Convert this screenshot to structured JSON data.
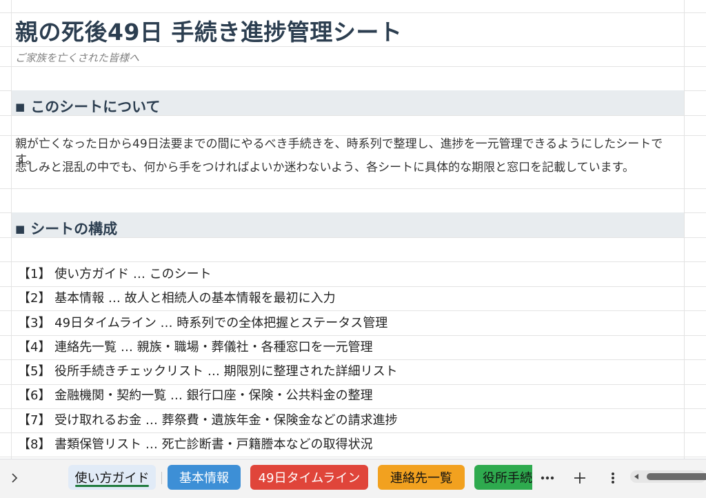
{
  "title": "親の死後49日 手続き進捗管理シート",
  "subtitle": "ご家族を亡くされた皆様へ",
  "about": {
    "bullet": "■",
    "heading": "このシートについて",
    "line1": "親が亡くなった日から49日法要までの間にやるべき手続きを、時系列で整理し、進捗を一元管理できるようにしたシートです。",
    "line2": "悲しみと混乱の中でも、何から手をつければよいか迷わないよう、各シートに具体的な期限と窓口を記載しています。"
  },
  "structure": {
    "bullet": "■",
    "heading": "シートの構成",
    "items": [
      "【1】 使い方ガイド … このシート",
      "【2】 基本情報 … 故人と相続人の基本情報を最初に入力",
      "【3】 49日タイムライン … 時系列での全体把握とステータス管理",
      "【4】 連絡先一覧 … 親族・職場・葬儀社・各種窓口を一元管理",
      "【5】 役所手続きチェックリスト … 期限別に整理された詳細リスト",
      "【6】 金融機関・契約一覧 … 銀行口座・保険・公共料金の整理",
      "【7】 受け取れるお金 … 葬祭費・遺族年金・保険金などの請求進捗",
      "【8】 書類保管リスト … 死亡診断書・戸籍謄本などの取得状況"
    ]
  },
  "tabs": [
    {
      "label": "使い方ガイド",
      "color": "#e1ebf7",
      "text": "#111111",
      "active": true
    },
    {
      "label": "基本情報",
      "color": "#3d8fd6",
      "text": "#ffffff",
      "active": false
    },
    {
      "label": "49日タイムライン",
      "color": "#e0453a",
      "text": "#ffffff",
      "active": false
    },
    {
      "label": "連絡先一覧",
      "color": "#f2a11f",
      "text": "#111111",
      "active": false
    },
    {
      "label": "役所手続",
      "color": "#2eaa4e",
      "text": "#111111",
      "active": false
    }
  ],
  "icons": {
    "sheet_list": "chevron-right-icon",
    "more": "more-horizontal-icon",
    "add": "plus-icon",
    "menu": "more-vertical-icon"
  },
  "colors": {
    "heading": "#2c3e50",
    "band": "#e8ecef",
    "active_tab_underline": "#1e7a3c"
  }
}
